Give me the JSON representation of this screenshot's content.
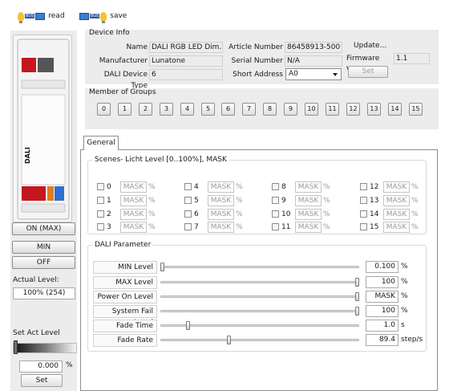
{
  "toolbar": {
    "read_label": "read",
    "save_label": "save"
  },
  "left": {
    "on_max_label": "ON (MAX)",
    "min_label": "MIN",
    "off_label": "OFF",
    "actual_level_label": "Actual Level:",
    "actual_level_value": "100% (254)",
    "set_act_level_label": "Set Act Level",
    "act_value": "0.000",
    "act_unit": "%",
    "set_label": "Set",
    "act_level_fraction": 0
  },
  "device_info": {
    "title": "Device Info",
    "name_label": "Name",
    "name_value": "DALI RGB LED Dim...",
    "manufacturer_label": "Manufacturer",
    "manufacturer_value": "Lunatone",
    "dali_type_label": "DALI Device Type",
    "dali_type_value": "6",
    "article_label": "Article Number",
    "article_value": "86458913-500",
    "serial_label": "Serial Number",
    "serial_value": "N/A",
    "short_addr_label": "Short Address",
    "short_addr_value": "A0",
    "update_label": "Update...",
    "firmware_label": "Firmware Ver",
    "firmware_value": "1.1",
    "set_label": "Set"
  },
  "groups": {
    "title": "Member of Groups",
    "items": [
      "0",
      "1",
      "2",
      "3",
      "4",
      "5",
      "6",
      "7",
      "8",
      "9",
      "10",
      "11",
      "12",
      "13",
      "14",
      "15"
    ]
  },
  "tabs": {
    "general_label": "General"
  },
  "scenes": {
    "title": "Scenes- Licht Level [0..100%], MASK",
    "mask_label": "MASK",
    "pct_label": "%",
    "items": [
      "0",
      "1",
      "2",
      "3",
      "4",
      "5",
      "6",
      "7",
      "8",
      "9",
      "10",
      "11",
      "12",
      "13",
      "14",
      "15"
    ]
  },
  "dali_params": {
    "title": "DALI Parameter",
    "rows": [
      {
        "label": "MIN Level",
        "value": "0.100",
        "unit": "%",
        "slider": 0.0
      },
      {
        "label": "MAX Level",
        "value": "100",
        "unit": "%",
        "slider": 1.0
      },
      {
        "label": "Power On Level",
        "value": "MASK",
        "unit": "%",
        "slider": 1.0
      },
      {
        "label": "System Fail Level",
        "value": "100",
        "unit": "%",
        "slider": 1.0
      },
      {
        "label": "Fade Time",
        "value": "1.0",
        "unit": "s",
        "slider": 0.13
      },
      {
        "label": "Fade Rate",
        "value": "89.4",
        "unit": "step/s",
        "slider": 0.34
      }
    ]
  }
}
